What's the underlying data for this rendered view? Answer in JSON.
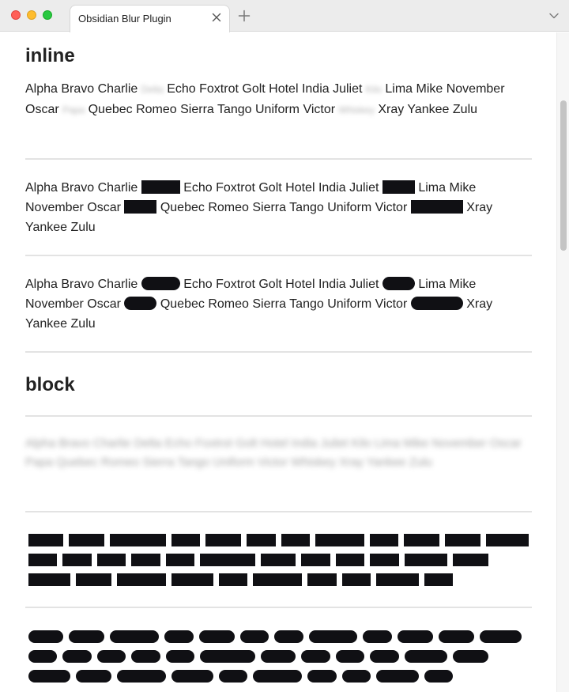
{
  "window": {
    "tab_title": "Obsidian Blur Plugin"
  },
  "sections": {
    "inline_heading": "inline",
    "block_heading": "block"
  },
  "inline_para": {
    "seg1": "Alpha Bravo Charlie",
    "hidden1": "Delta",
    "seg2": "Echo Foxtrot Golt Hotel India Juliet",
    "hidden2": "Kilo",
    "seg3": "Lima Mike November Oscar",
    "hidden3": "Papa",
    "seg4": "Quebec Romeo Sierra Tango Uniform Victor",
    "hidden4": "Whiskey",
    "seg5": "Xray Yankee Zulu"
  },
  "block_blur_text": "Alpha Bravo Charlie Delta Echo Foxtrot Golt Hotel India Juliet Kilo Lima Mike November Oscar Papa Quebec Romeo Sierra Tango Uniform Victor Whiskey Xray Yankee Zulu",
  "colors": {
    "redaction": "#101014",
    "rule": "#e3e3e3"
  },
  "icons": {
    "tab_close": "close-icon",
    "new_tab": "plus-icon",
    "tab_list": "chevron-down-icon"
  }
}
